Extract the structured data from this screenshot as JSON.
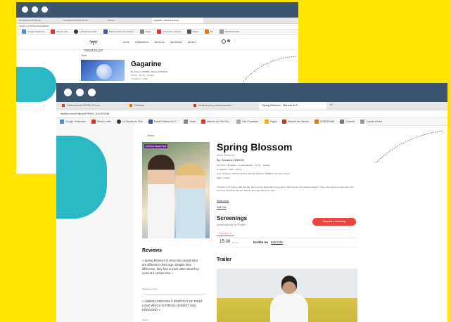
{
  "back_window": {
    "tabs": [
      "Coronavirus COVID-19 ...",
      "Livestream Festival de Ca...",
      "Cannes",
      "Gagarine - Marché du Film"
    ],
    "url": "bazfilm.com/fr/films/GAGARINE",
    "bookmarks": [
      "Google Traduction",
      "Film en ville",
      "Le Marché du Film",
      "Portail Festival de Cannes",
      "Stage",
      "Festival de Cannes",
      "Tweet",
      "FR",
      "Marché du Film"
    ],
    "brand": "MARCHÉ DU FILM",
    "brand_sub": "FESTIVAL DE CANNES",
    "nav": [
      "FILMS",
      "SCREENINGS",
      "PROFILES",
      "MESSAGES",
      "EVENTS"
    ],
    "back_link": "← Back",
    "film_title": "Gagarine",
    "film_meta": "By: Fanny LIATARD, Jérémy TROUILH",
    "film_meta2": "Drama · 95 min · France",
    "film_meta3": "Completed · 2020"
  },
  "front_window": {
    "tabs": [
      "Coronavirus COVID-19 Live...",
      "Cinando",
      "Festival des professionnels ...",
      "Spring Blossom - Marché du F..."
    ],
    "url": "bazfilm.com/fr/films/SPRING_BLOSSOM",
    "bookmarks": [
      "Google Traduction",
      "Films en ville",
      "Le Marché du Film",
      "Portail Festival de C...",
      "Tweet",
      "Marché du Film Onl...",
      "Tout Connecter",
      "Pages",
      "Marché de Cannes",
      "SYNDROME",
      "Cinando",
      "Cannes Online"
    ],
    "back_link": "← Back",
    "poster_badge": "OFFICIAL SELECTION",
    "title": "Spring Blossom",
    "subtitle1": "Seize Printemps",
    "subtitle2": "By: Suzanne LINDON",
    "meta_lines": [
      "First Film · Romance · Female director · 73 min · France",
      "Completed · 2020 · Fiction",
      "Cast: Suzanne LINDON, Arnaud VALOIS, Frédéric PIERROT, Florence VIALA",
      "Sales: Luxbox"
    ],
    "synopsis": "Suzanne is 16. Fed up with her age, she is bored. Every day on her way to high school, she passes a theater. There, she meets an older man, who becomes obsessed with her. Despite their age difference, they...",
    "read_more": "Read more",
    "edit_film": "Edit Film",
    "screenings_title": "Screenings",
    "screenings_sub": "Screening only for Profiles",
    "screening_cta": "Request a screening",
    "screening_tab": "MONDAY 22",
    "screening_time": "15:30",
    "screening_unit": "25 min",
    "screening_status": "Invités ou",
    "screening_link": "Edit Film",
    "reviews_title": "Reviews",
    "review1": "« Spring Blossom is about two people who are different in their age. Despite their difference, they find in each other what they need at a certain time »",
    "review1_source": "Suzanne Lindon",
    "review2": "« LINDON CREATES A PORTRAIT OF FIRST LOVE WHICH IS FRESH, HONEST AND ENGAGING »",
    "review2_source": "Variety",
    "trailer_title": "Trailer"
  },
  "colors": {
    "background": "#ffe500",
    "titlebar": "#3d5570",
    "accent_red": "#e8473f",
    "teal": "#2ab8c4"
  }
}
